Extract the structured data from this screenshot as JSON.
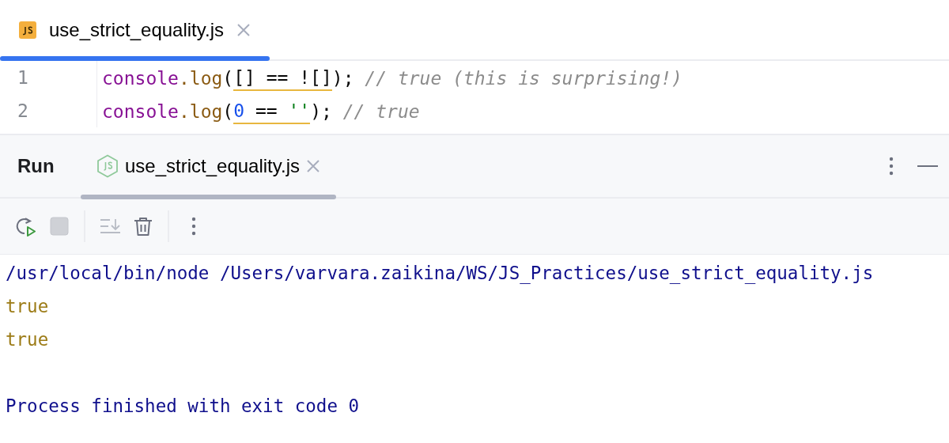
{
  "editor_tab": {
    "label": "use_strict_equality.js",
    "selected": true
  },
  "code_lines": [
    {
      "number": "1",
      "tokens": [
        {
          "text": "console",
          "kind": "ident"
        },
        {
          "text": ".log",
          "kind": "method"
        },
        {
          "text": "(",
          "kind": "punct"
        },
        {
          "text": "[] == ![]",
          "kind": "punct",
          "warning": true
        },
        {
          "text": ");",
          "kind": "punct"
        },
        {
          "text": " // true (this is surprising!)",
          "kind": "comment"
        }
      ]
    },
    {
      "number": "2",
      "tokens": [
        {
          "text": "console",
          "kind": "ident"
        },
        {
          "text": ".log",
          "kind": "method"
        },
        {
          "text": "(",
          "kind": "punct"
        },
        {
          "text": "0",
          "kind": "number",
          "warning": true
        },
        {
          "text": " == ",
          "kind": "punct",
          "warning": true
        },
        {
          "text": "''",
          "kind": "string",
          "warning": true
        },
        {
          "text": ");",
          "kind": "punct"
        },
        {
          "text": " // true",
          "kind": "comment"
        }
      ]
    }
  ],
  "run_panel": {
    "title": "Run",
    "tab": {
      "label": "use_strict_equality.js",
      "selected": true
    },
    "toolbar": [
      {
        "kind": "rerun",
        "disabled": false
      },
      {
        "kind": "stop",
        "disabled": true
      },
      {
        "kind": "scroll-end",
        "disabled": true
      },
      {
        "kind": "clear",
        "disabled": false
      },
      {
        "kind": "more",
        "disabled": false
      }
    ]
  },
  "console_lines": [
    {
      "text": "/usr/local/bin/node /Users/varvara.zaikina/WS/JS_Practices/use_strict_equality.js",
      "kind": "command"
    },
    {
      "text": "true",
      "kind": "output"
    },
    {
      "text": "true",
      "kind": "output"
    },
    {
      "text": "Process finished with exit code 0",
      "kind": "exit"
    }
  ]
}
